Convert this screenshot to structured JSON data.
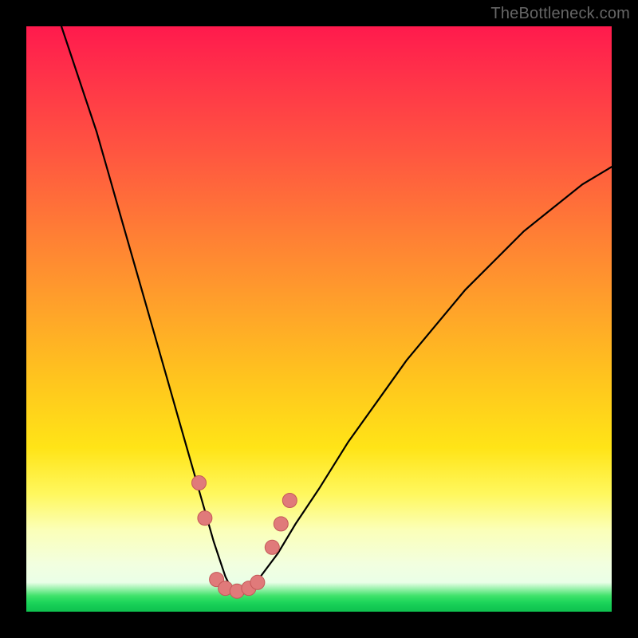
{
  "watermark": "TheBottleneck.com",
  "colors": {
    "frame": "#000000",
    "curve_stroke": "#000000",
    "marker_fill": "#e07a7a",
    "marker_stroke": "#c45858",
    "gradient_top": "#ff1a4d",
    "gradient_bottom": "#0fc24f"
  },
  "chart_data": {
    "type": "line",
    "title": "",
    "xlabel": "",
    "ylabel": "",
    "xlim": [
      0,
      100
    ],
    "ylim": [
      0,
      100
    ],
    "grid": false,
    "legend": false,
    "series": [
      {
        "name": "curve",
        "x": [
          6,
          8,
          10,
          12,
          14,
          16,
          18,
          20,
          22,
          24,
          26,
          28,
          30,
          32,
          33,
          34,
          35,
          36,
          37,
          38,
          40,
          43,
          46,
          50,
          55,
          60,
          65,
          70,
          75,
          80,
          85,
          90,
          95,
          100
        ],
        "y": [
          100,
          94,
          88,
          82,
          75,
          68,
          61,
          54,
          47,
          40,
          33,
          26,
          19,
          12,
          9,
          6,
          4,
          3,
          3,
          4,
          6,
          10,
          15,
          21,
          29,
          36,
          43,
          49,
          55,
          60,
          65,
          69,
          73,
          76
        ]
      }
    ],
    "markers": [
      {
        "name": "left-upper",
        "x": 29.5,
        "y": 22
      },
      {
        "name": "left-lower",
        "x": 30.5,
        "y": 16
      },
      {
        "name": "valley-1",
        "x": 32.5,
        "y": 5.5
      },
      {
        "name": "valley-2",
        "x": 34.0,
        "y": 4.0
      },
      {
        "name": "valley-3",
        "x": 36.0,
        "y": 3.5
      },
      {
        "name": "valley-4",
        "x": 38.0,
        "y": 4.0
      },
      {
        "name": "valley-5",
        "x": 39.5,
        "y": 5.0
      },
      {
        "name": "right-lower",
        "x": 42.0,
        "y": 11
      },
      {
        "name": "right-mid",
        "x": 43.5,
        "y": 15
      },
      {
        "name": "right-upper",
        "x": 45.0,
        "y": 19
      }
    ]
  }
}
